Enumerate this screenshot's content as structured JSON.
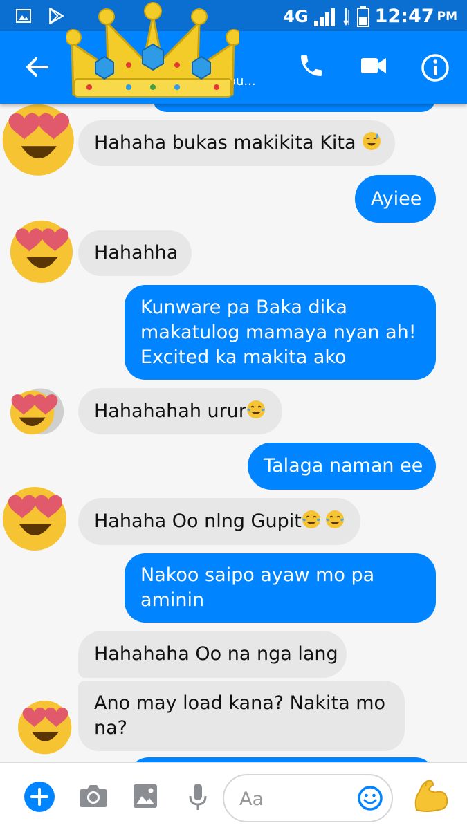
{
  "status": {
    "network": "4G",
    "time": "12:47",
    "ampm": "PM"
  },
  "header": {
    "contact_subtitle": "ou...",
    "sticker": "crown"
  },
  "messages": [
    {
      "side": "in",
      "text": "Hahaha bukas makikita Kita",
      "emoji": "sweat-smile-emoji"
    },
    {
      "side": "out",
      "text": "Ayiee"
    },
    {
      "side": "in",
      "text": "Hahahha"
    },
    {
      "side": "out",
      "lines": [
        "Kunware pa Baka dika",
        "makatulog mamaya nyan ah!",
        "Excited ka makita ako"
      ]
    },
    {
      "side": "in",
      "text": "Hahahahah urur",
      "emoji": "tears-of-joy-emoji"
    },
    {
      "side": "out",
      "text": "Talaga naman ee"
    },
    {
      "side": "in",
      "text": "Hahaha Oo nlng Gupit",
      "emoji": "tears-of-joy-emoji x2"
    },
    {
      "side": "out",
      "lines": [
        "Nakoo saipo ayaw mo pa",
        "aminin"
      ]
    },
    {
      "side": "in",
      "text": "Hahahaha Oo na nga lang"
    },
    {
      "side": "in",
      "lines": [
        "Ano may load kana? Nakita mo",
        "na?"
      ]
    }
  ],
  "composer": {
    "placeholder": "Aa"
  },
  "colors": {
    "accent": "#0084ff",
    "statusbar": "#0a6fd0",
    "incoming": "#e7e7e7"
  }
}
